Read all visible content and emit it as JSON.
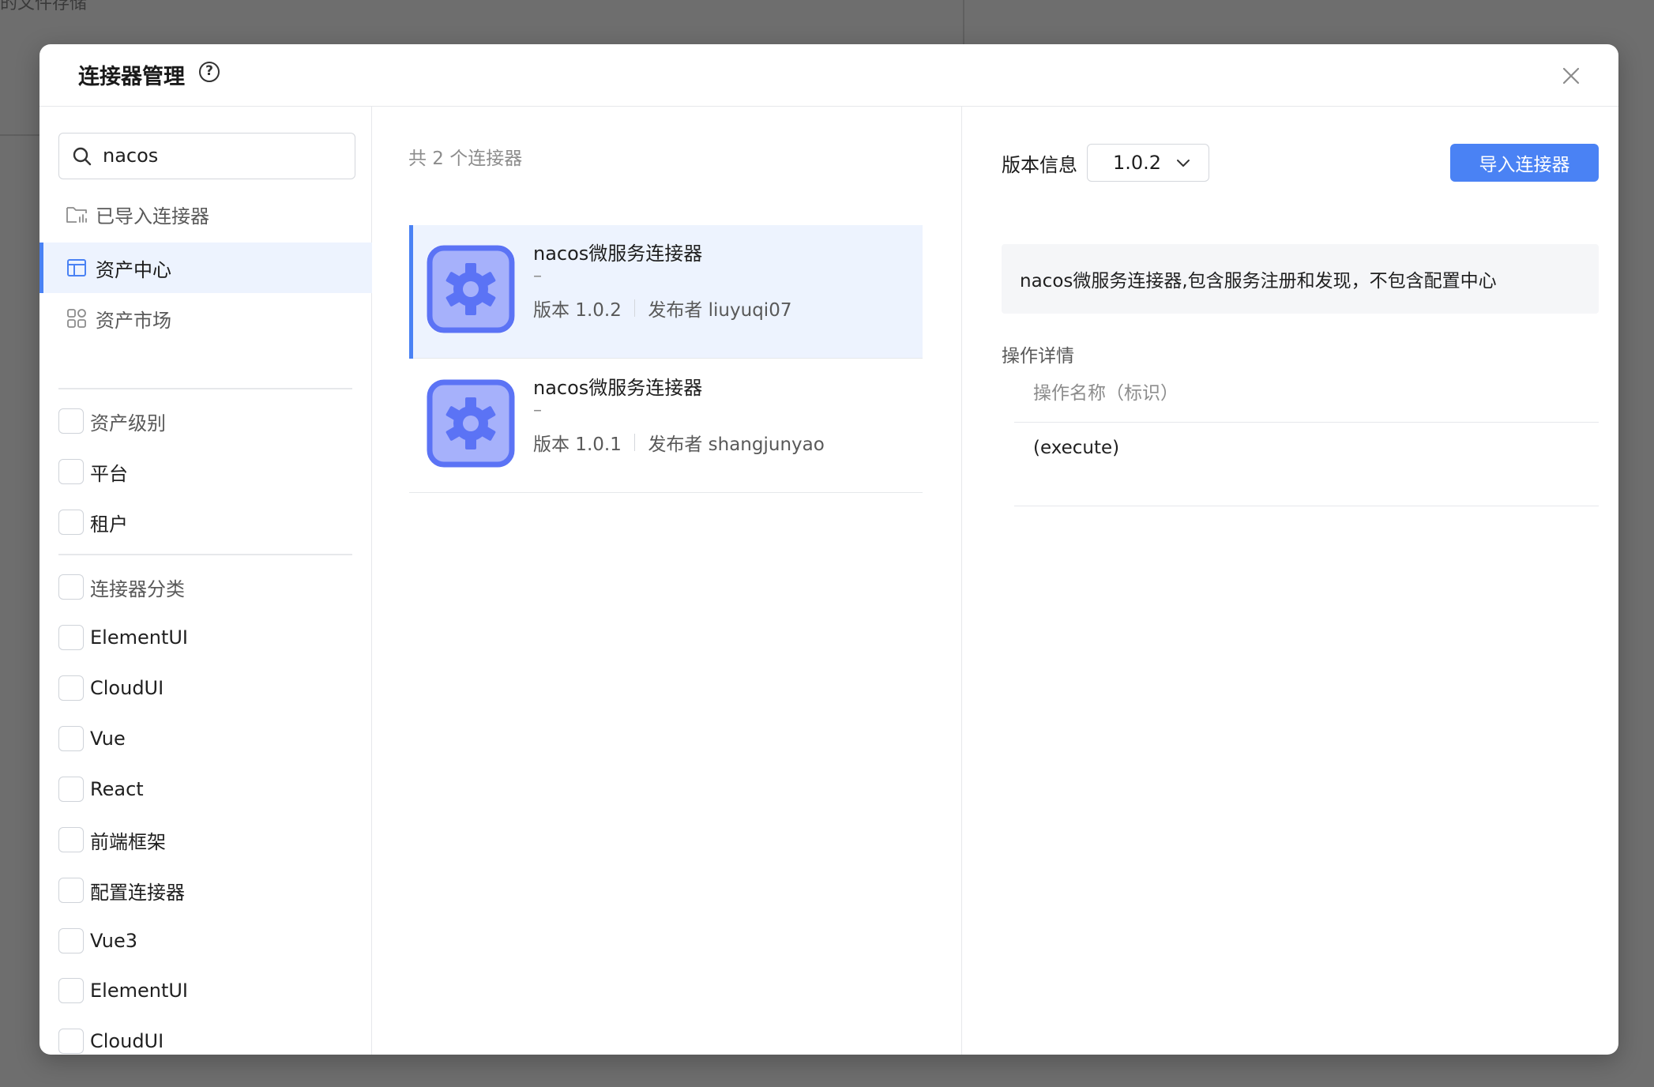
{
  "background": {
    "text": "的文件存储"
  },
  "modal": {
    "title": "连接器管理"
  },
  "search": {
    "value": "nacos",
    "placeholder": ""
  },
  "nav": {
    "imported": "已导入连接器",
    "asset_center": "资产中心",
    "asset_market": "资产市场"
  },
  "filters": {
    "level_group": "资产级别",
    "platform": "平台",
    "tenant": "租户",
    "category_group": "连接器分类",
    "categories": [
      "ElementUI",
      "CloudUI",
      "Vue",
      "React",
      "前端框架",
      "配置连接器",
      "Vue3",
      "ElementUI",
      "CloudUI"
    ]
  },
  "list": {
    "count_label": "共 2 个连接器",
    "items": [
      {
        "title": "nacos微服务连接器",
        "desc": "–",
        "version": "版本 1.0.2",
        "publisher": "发布者 liuyuqi07"
      },
      {
        "title": "nacos微服务连接器",
        "desc": "–",
        "version": "版本 1.0.1",
        "publisher": "发布者 shangjunyao"
      }
    ]
  },
  "detail": {
    "version_label": "版本信息",
    "version_value": "1.0.2",
    "import_button": "导入连接器",
    "description": "nacos微服务连接器,包含服务注册和发现，不包含配置中心",
    "ops_label": "操作详情",
    "ops_header": "操作名称（标识）",
    "ops_rows": [
      "(execute)"
    ]
  },
  "colors": {
    "accent": "#4a82f4",
    "active_bg": "#edf3fe",
    "icon_fill": "#a6b1fb",
    "icon_stroke": "#5b73f5"
  }
}
